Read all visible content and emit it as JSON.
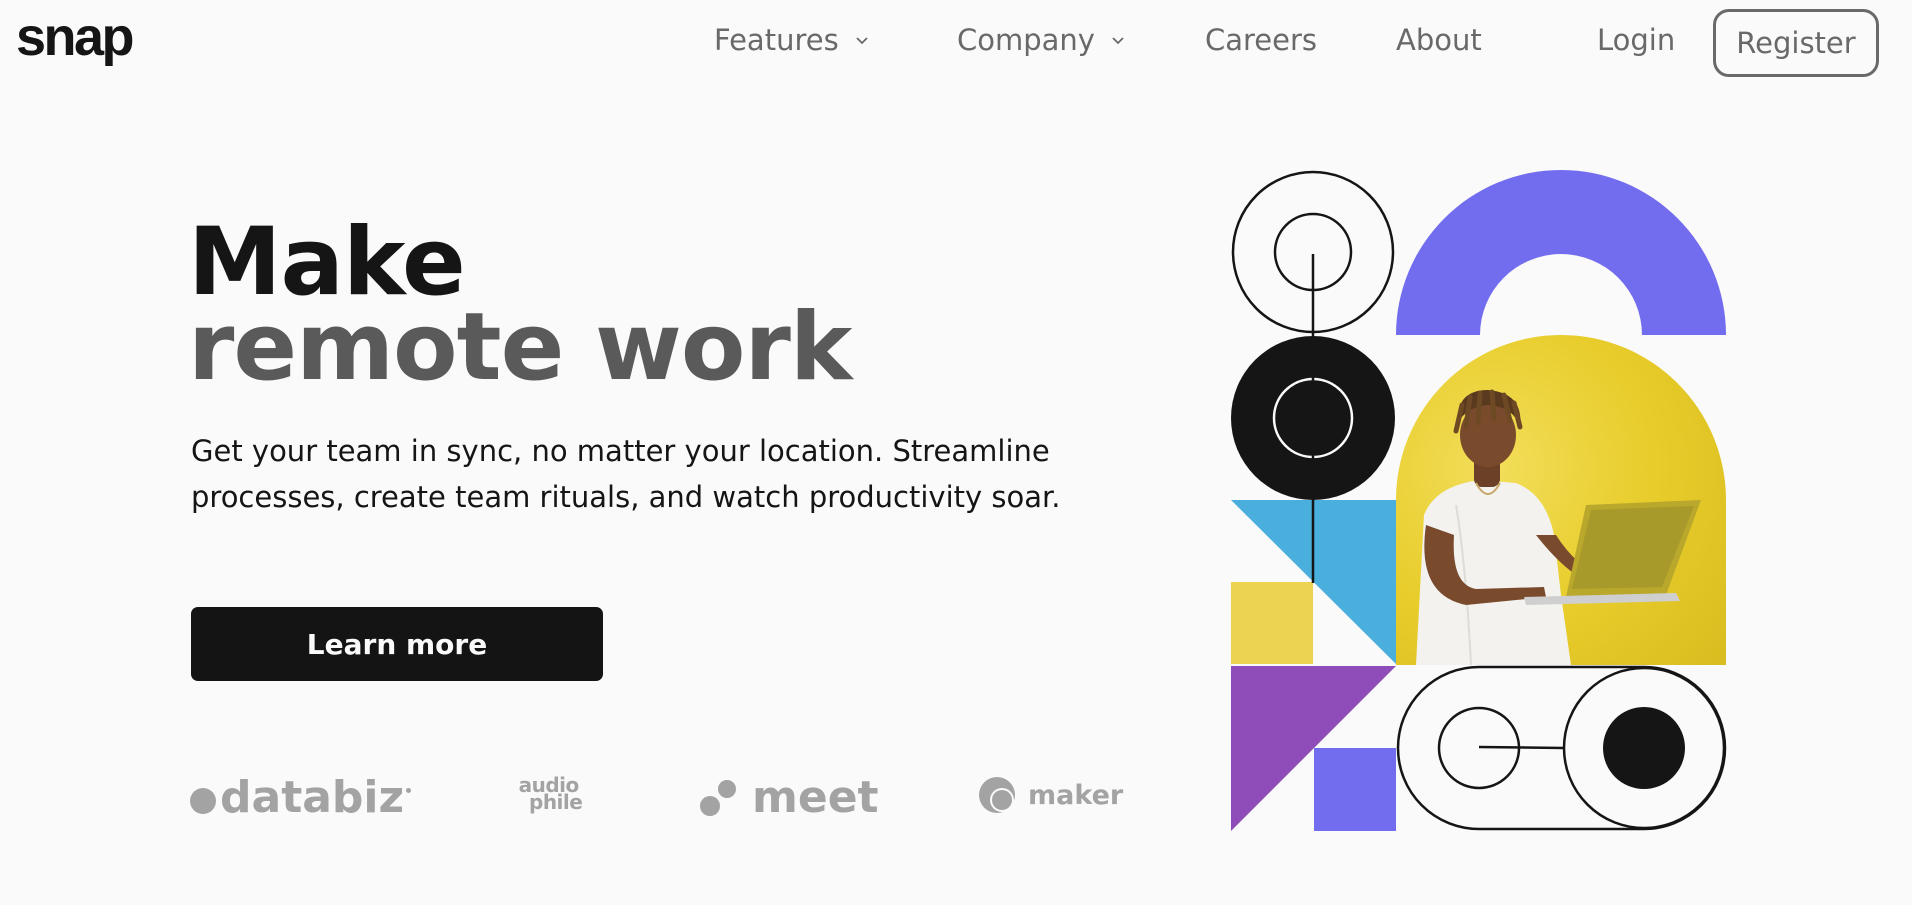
{
  "header": {
    "logo": "snap",
    "nav": {
      "features": "Features",
      "company": "Company",
      "careers": "Careers",
      "about": "About"
    },
    "login": "Login",
    "register": "Register"
  },
  "hero": {
    "title_line1": "Make",
    "title_line2": "remote work",
    "description": "Get your team in sync, no matter your location. Streamline processes, create team rituals, and watch productivity soar.",
    "cta": "Learn more"
  },
  "clients": {
    "databiz": "databiz",
    "audiophile_line1": "audio",
    "audiophile_line2": "phile",
    "meet": "meet",
    "maker": "maker"
  },
  "colors": {
    "background": "#fafafa",
    "text_dark": "#151515",
    "text_gray": "#696969",
    "purple": "#726cee",
    "yellow": "#e9cf2e",
    "blue": "#4aafdc",
    "violet": "#8e4db8"
  }
}
